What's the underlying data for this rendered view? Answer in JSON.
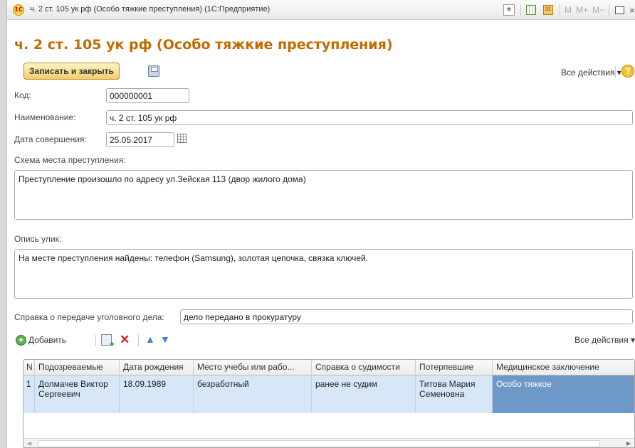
{
  "window": {
    "title": "ч. 2 ст. 105 ук рф (Особо тяжкие преступления)  (1С:Предприятие)",
    "logo_text": "1С",
    "memory_buttons": [
      "M",
      "M+",
      "M−"
    ]
  },
  "document": {
    "title": "ч. 2 ст. 105 ук рф (Особо тяжкие преступления)"
  },
  "toolbar": {
    "save_close_label": "Записать и закрыть",
    "all_actions_label": "Все действия ▾",
    "help_label": "?"
  },
  "form": {
    "code_label": "Код:",
    "code_value": "000000001",
    "name_label": "Наименование:",
    "name_value": "ч. 2 ст. 105 ук рф",
    "date_label": "Дата совершения:",
    "date_value": "25.05.2017",
    "scheme_label": "Схема места преступления:",
    "scheme_value": "Преступление произошло по адресу ул.Зейская 113 (двор жилого дома)",
    "evidence_label": "Опись улик:",
    "evidence_value": "На месте преступления найдены: телефон (Samsung), золотая цепочка, связка ключей.",
    "transfer_label": "Справка о передаче уголовного дела:",
    "transfer_value": "дело передано в прокуратуру"
  },
  "table_toolbar": {
    "add_label": "Добавить",
    "all_actions_label": "Все действия ▾"
  },
  "table": {
    "columns": [
      "N",
      "Подозреваемые",
      "Дата рождения",
      "Место учебы или рабо...",
      "Справка о судимости",
      "Потерпевшие",
      "Медицинское заключение"
    ],
    "rows": [
      [
        "1",
        "Долмачев Виктор Сергеевич",
        "18.09.1989",
        "безработный",
        "ранее не судим",
        "Титова Мария Семеновна",
        "Особо тяжкое"
      ]
    ]
  },
  "colors": {
    "title_accent": "#c36900",
    "button_fill": "#f1cf6a",
    "row_highlight": "#d7e7f7",
    "cell_selected": "#6e98c7"
  }
}
